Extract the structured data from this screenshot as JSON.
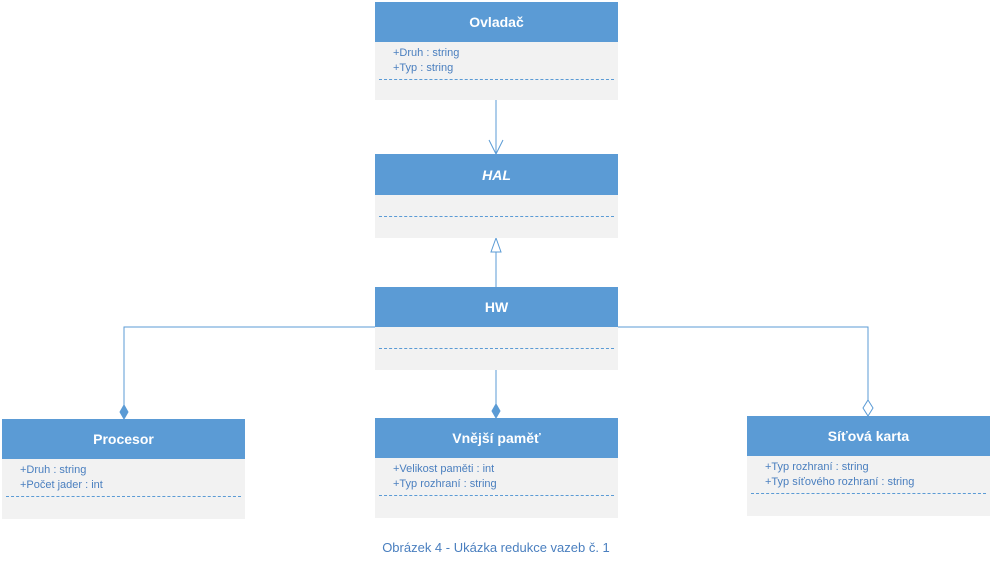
{
  "classes": {
    "ovladac": {
      "name": "Ovladač",
      "attributes": [
        "+Druh : string",
        "+Typ : string"
      ]
    },
    "hal": {
      "name": "HAL",
      "attributes": []
    },
    "hw": {
      "name": "HW",
      "attributes": []
    },
    "procesor": {
      "name": "Procesor",
      "attributes": [
        "+Druh : string",
        "+Počet jader : int"
      ]
    },
    "vnejsi_pamet": {
      "name": "Vnější paměť",
      "attributes": [
        "+Velikost paměti : int",
        "+Typ rozhraní : string"
      ]
    },
    "sitova_karta": {
      "name": "Síťová karta",
      "attributes": [
        "+Typ rozhraní : string",
        "+Typ síťového rozhraní : string"
      ]
    }
  },
  "caption": "Obrázek 4 - Ukázka redukce vazeb č. 1",
  "colors": {
    "header": "#5b9bd5",
    "body": "#f2f2f2",
    "line": "#5b9bd5",
    "text": "#4a7fbf"
  }
}
